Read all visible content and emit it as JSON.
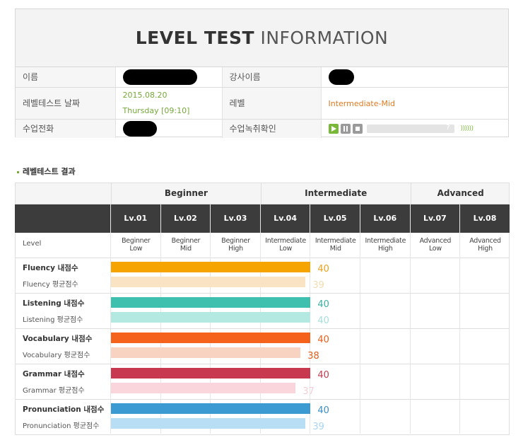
{
  "header": {
    "title_bold": "LEVEL TEST",
    "title_light": "INFORMATION"
  },
  "info": {
    "name_label": "이름",
    "teacher_label": "강사이름",
    "date_label": "레벨테스트 날짜",
    "date_line1": "2015.08.20",
    "date_line2": "Thursday [09:10]",
    "level_label": "레벨",
    "level_value": "Intermediate-Mid",
    "phone_label": "수업전화",
    "recording_label": "수업녹취확인",
    "player_help": "?",
    "player_volume": "))))))"
  },
  "result": {
    "title": "레벨테스트 결과",
    "bands": [
      "Beginner",
      "Intermediate",
      "Advanced"
    ],
    "levels": [
      "Lv.01",
      "Lv.02",
      "Lv.03",
      "Lv.04",
      "Lv.05",
      "Lv.06",
      "Lv.07",
      "Lv.08"
    ],
    "level_header": "Level",
    "level_desc": [
      [
        "Beginner",
        "Low"
      ],
      [
        "Beginner",
        "Mid"
      ],
      [
        "Beginner",
        "High"
      ],
      [
        "Intermediate",
        "Low"
      ],
      [
        "Intermediate",
        "Mid"
      ],
      [
        "Intermediate",
        "High"
      ],
      [
        "Advanced",
        "Low"
      ],
      [
        "Advanced",
        "High"
      ]
    ],
    "score_max": 80,
    "categories": [
      {
        "mine_label": "Fluency 내점수",
        "avg_label": "Fluency 평균점수",
        "mine": 40,
        "avg": 39,
        "color": "#f6a500",
        "avg_color": "#f9e3c2",
        "mine_text_color": "#e8a21c",
        "avg_text_color": "#f3dcb0"
      },
      {
        "mine_label": "Listening 내점수",
        "avg_label": "Listening 평균점수",
        "mine": 40,
        "avg": 40,
        "color": "#3fbfad",
        "avg_color": "#b4e9e1",
        "mine_text_color": "#3ab0a0",
        "avg_text_color": "#a6e0d8"
      },
      {
        "mine_label": "Vocabulary 내점수",
        "avg_label": "Vocabulary 평균점수",
        "mine": 40,
        "avg": 38,
        "color": "#f5621b",
        "avg_color": "#f8d3c1",
        "mine_text_color": "#e8601c",
        "avg_text_color": "#e35c18"
      },
      {
        "mine_label": "Grammar 내점수",
        "avg_label": "Grammar 평균점수",
        "mine": 40,
        "avg": 37,
        "color": "#c8394f",
        "avg_color": "#fad6dc",
        "mine_text_color": "#c03c50",
        "avg_text_color": "#f5cfd5"
      },
      {
        "mine_label": "Pronunciation 내점수",
        "avg_label": "Pronunciation 평균점수",
        "mine": 40,
        "avg": 39,
        "color": "#3b9ad2",
        "avg_color": "#b7def4",
        "mine_text_color": "#3a8fc7",
        "avg_text_color": "#a9d4ef"
      }
    ]
  }
}
